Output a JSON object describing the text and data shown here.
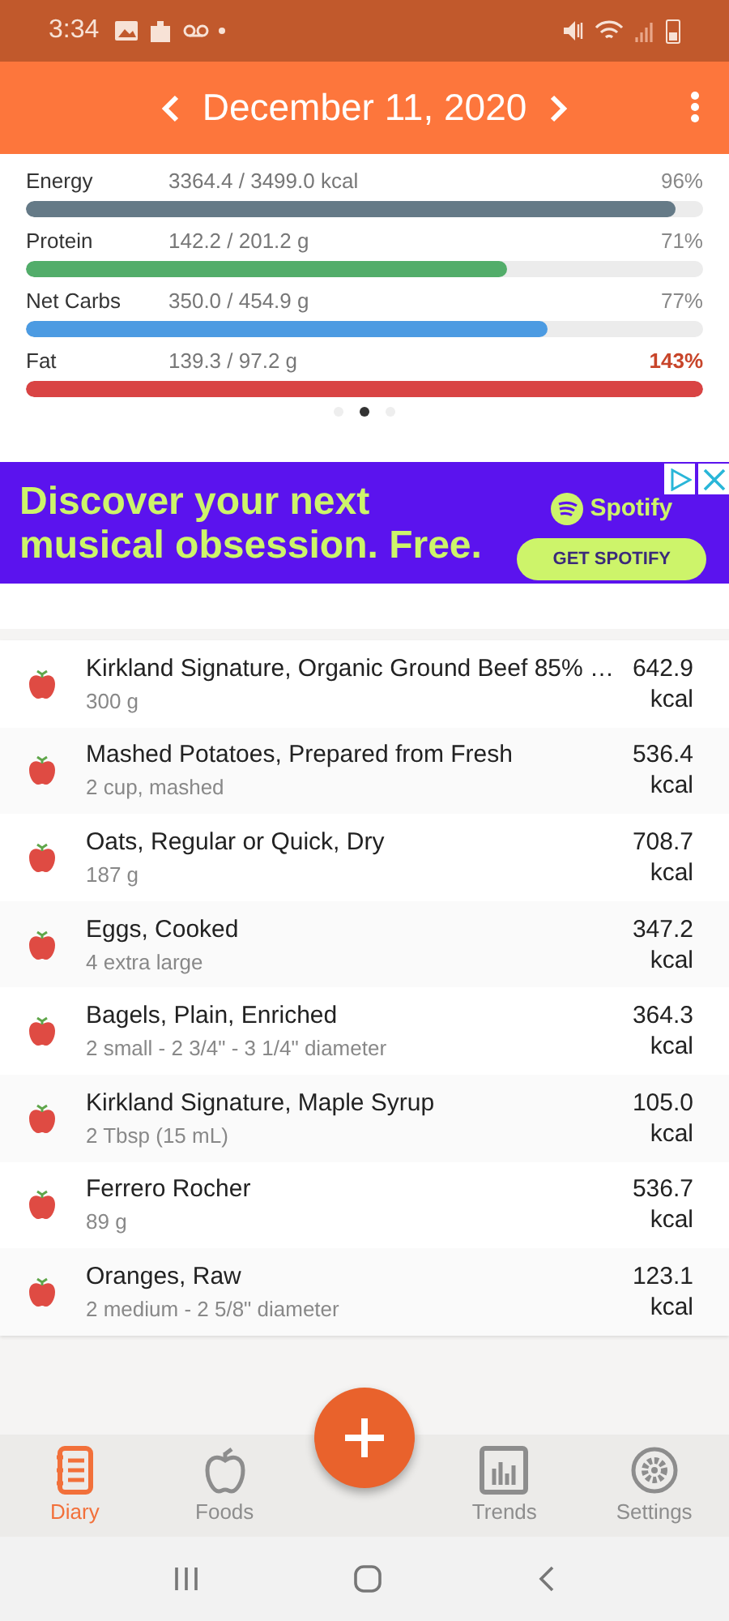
{
  "status_bar": {
    "time": "3:34"
  },
  "header": {
    "date": "December 11, 2020"
  },
  "macros": [
    {
      "name": "Energy",
      "amount": "3364.4 / 3499.0 kcal",
      "percent": "96%",
      "over": false,
      "level": 0.96,
      "color": "#657a87"
    },
    {
      "name": "Protein",
      "amount": "142.2 / 201.2 g",
      "percent": "71%",
      "over": false,
      "level": 0.71,
      "color": "#52ad6a"
    },
    {
      "name": "Net Carbs",
      "amount": "350.0 / 454.9 g",
      "percent": "77%",
      "over": false,
      "level": 0.77,
      "color": "#4c9be2"
    },
    {
      "name": "Fat",
      "amount": "139.3 / 97.2 g",
      "percent": "143%",
      "over": true,
      "level": 1,
      "color": "#d94444"
    }
  ],
  "page_dots": [
    {
      "selected": false
    },
    {
      "selected": true
    },
    {
      "selected": false
    }
  ],
  "ad": {
    "headline": "Discover your next musical obsession. Free.",
    "brand": "Spotify",
    "button": "GET SPOTIFY"
  },
  "foods": [
    {
      "name": "Kirkland Signature, Organic Ground Beef 85% …",
      "amount": "300 g",
      "energy": "642.9",
      "unit": "kcal"
    },
    {
      "name": "Mashed Potatoes, Prepared from Fresh",
      "amount": "2 cup, mashed",
      "energy": "536.4",
      "unit": "kcal"
    },
    {
      "name": "Oats, Regular or Quick, Dry",
      "amount": "187 g",
      "energy": "708.7",
      "unit": "kcal"
    },
    {
      "name": "Eggs, Cooked",
      "amount": "4 extra large",
      "energy": "347.2",
      "unit": "kcal"
    },
    {
      "name": "Bagels, Plain, Enriched",
      "amount": "2 small - 2 3/4\" - 3 1/4\" diameter",
      "energy": "364.3",
      "unit": "kcal"
    },
    {
      "name": "Kirkland Signature, Maple Syrup",
      "amount": "2 Tbsp (15 mL)",
      "energy": "105.0",
      "unit": "kcal"
    },
    {
      "name": "Ferrero Rocher",
      "amount": "89 g",
      "energy": "536.7",
      "unit": "kcal"
    },
    {
      "name": "Oranges, Raw",
      "amount": "2 medium - 2 5/8\" diameter",
      "energy": "123.1",
      "unit": "kcal"
    }
  ],
  "nav": [
    {
      "kind": "diary",
      "label": "Diary",
      "selected": true
    },
    {
      "kind": "foods",
      "label": "Foods",
      "selected": false
    },
    {
      "kind": "add"
    },
    {
      "kind": "trends",
      "label": "Trends",
      "selected": false
    },
    {
      "kind": "settings",
      "label": "Settings",
      "selected": false
    }
  ]
}
